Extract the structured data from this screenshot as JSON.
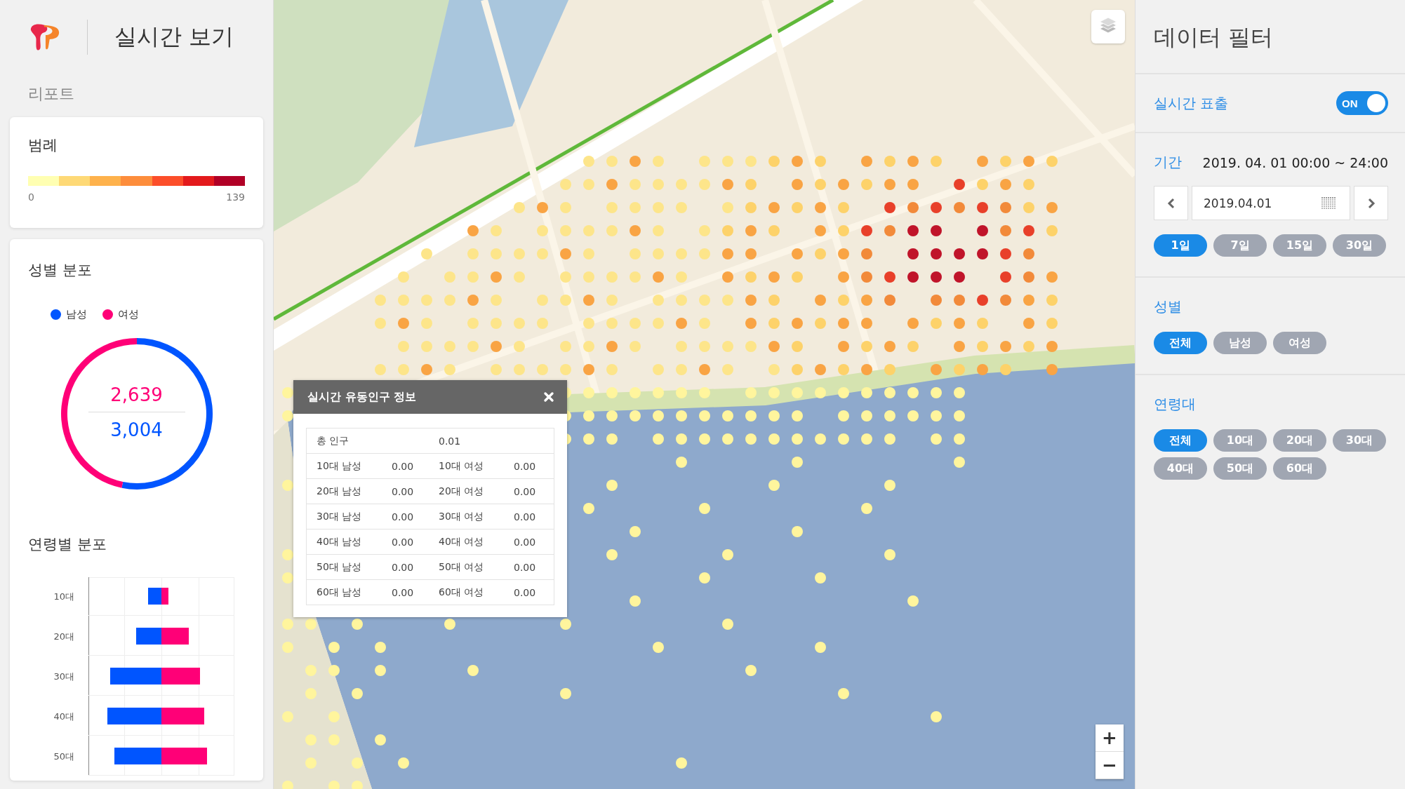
{
  "header": {
    "title": "실시간 보기"
  },
  "report_heading": "리포트",
  "legend_card": {
    "title": "범례",
    "scale": [
      {
        "color": "#ffffb2"
      },
      {
        "color": "#fed976"
      },
      {
        "color": "#feb24c"
      },
      {
        "color": "#fd8d3c"
      },
      {
        "color": "#fc4e2a"
      },
      {
        "color": "#e31a1c"
      },
      {
        "color": "#b10026"
      }
    ],
    "min_label": "0",
    "max_label": "139"
  },
  "gender_card": {
    "title": "성별 분포",
    "legend": [
      {
        "color": "#0055ff"
      },
      {
        "color": "#ff0077"
      }
    ],
    "chart_data": {
      "type": "donut",
      "categories": [
        "남성",
        "여성"
      ],
      "values": [
        53.2,
        46.8
      ]
    },
    "center_labels": [
      {
        "text": "2,639",
        "color": "#ff0077"
      },
      {
        "text": "3,004",
        "color": "#0055ff"
      }
    ]
  },
  "age_card": {
    "title": "연령별 분포",
    "rows": [
      {
        "label": "10대"
      },
      {
        "label": "20대"
      },
      {
        "label": "30대"
      },
      {
        "label": "40대"
      },
      {
        "label": "50대"
      }
    ]
  },
  "popup": {
    "title": "실시간 유동인구 정보",
    "total": {
      "label": "총 인구",
      "value": "0.01"
    },
    "rows": [
      {
        "male_label": "10대 남성",
        "male_value": "0.00",
        "female_label": "10대 여성",
        "female_value": "0.00"
      },
      {
        "male_label": "20대 남성",
        "male_value": "0.00",
        "female_label": "20대 여성",
        "female_value": "0.00"
      },
      {
        "male_label": "30대 남성",
        "male_value": "0.00",
        "female_label": "30대 여성",
        "female_value": "0.00"
      },
      {
        "male_label": "40대 남성",
        "male_value": "0.00",
        "female_label": "40대 여성",
        "female_value": "0.00"
      },
      {
        "male_label": "50대 남성",
        "male_value": "0.00",
        "female_label": "50대 여성",
        "female_value": "0.00"
      },
      {
        "male_label": "60대 남성",
        "male_value": "0.00",
        "female_label": "60대 여성",
        "female_value": "0.00"
      }
    ]
  },
  "map_controls": {
    "zoom_in": "+",
    "zoom_out": "−"
  },
  "filter": {
    "title": "데이터 필터",
    "realtime": {
      "label": "실시간 표출",
      "on": true,
      "toggle_text": "ON"
    },
    "period": {
      "label": "기간",
      "range": "2019. 04. 01 00:00 ~ 24:00",
      "date": "2019.04.01",
      "options": [
        {
          "label": "1일",
          "selected": true
        },
        {
          "label": "7일",
          "selected": false
        },
        {
          "label": "15일",
          "selected": false
        },
        {
          "label": "30일",
          "selected": false
        }
      ]
    },
    "gender": {
      "label": "성별",
      "options": [
        {
          "label": "전체",
          "selected": true
        },
        {
          "label": "남성",
          "selected": false
        },
        {
          "label": "여성",
          "selected": false
        }
      ]
    },
    "age": {
      "label": "연령대",
      "options": [
        {
          "label": "전체",
          "selected": true
        },
        {
          "label": "10대",
          "selected": false
        },
        {
          "label": "20대",
          "selected": false
        },
        {
          "label": "30대",
          "selected": false
        },
        {
          "label": "40대",
          "selected": false
        },
        {
          "label": "50대",
          "selected": false
        },
        {
          "label": "60대",
          "selected": false
        }
      ]
    }
  }
}
